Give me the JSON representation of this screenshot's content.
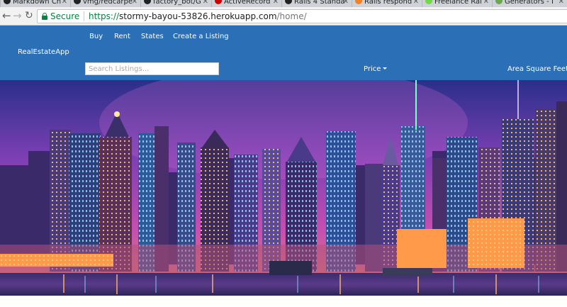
{
  "browser": {
    "tabs": [
      {
        "label": "Markdown Ch",
        "icon": "github-icon",
        "color": "#222222"
      },
      {
        "label": "vmg/redcarpe",
        "icon": "github-icon",
        "color": "#222222"
      },
      {
        "label": "factory_bot/G",
        "icon": "github-icon",
        "color": "#222222"
      },
      {
        "label": "ActiveRecord",
        "icon": "rails-icon",
        "color": "#cc0000"
      },
      {
        "label": "Rails 4 Standa",
        "icon": "github-icon",
        "color": "#222222"
      },
      {
        "label": "Rails respond",
        "icon": "stackoverflow-icon",
        "color": "#f48024"
      },
      {
        "label": "Freelance Rai",
        "icon": "upwork-icon",
        "color": "#6fda44"
      },
      {
        "label": "Generators - I",
        "icon": "page-icon",
        "color": "#6aa84f"
      }
    ],
    "secure_label": "Secure",
    "url_scheme": "https://",
    "url_host": "stormy-bayou-53826.herokuapp.com",
    "url_path": "/home/"
  },
  "site": {
    "brand": "RealEstateApp",
    "nav": [
      "Buy",
      "Rent",
      "States",
      "Create a Listing"
    ],
    "search_placeholder": "Search Listings...",
    "price_label": "Price",
    "area_label": "Area Square Feet",
    "navbar_color": "#2b6fb6"
  }
}
